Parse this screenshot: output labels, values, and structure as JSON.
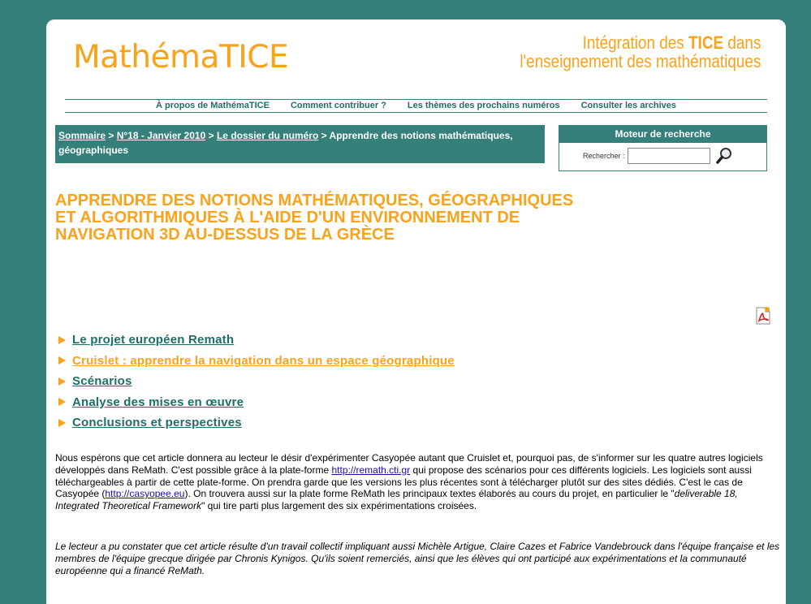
{
  "site": {
    "logo": "MathémaTICE",
    "tagline_line1_a": "Intégration des ",
    "tagline_line1_b": "TICE",
    "tagline_line1_c": " dans",
    "tagline_line2": "l'enseignement des mathématiques"
  },
  "nav": [
    "À propos de MathémaTICE",
    "Comment contribuer ?",
    "Les thèmes des prochains numéros",
    "Consulter les archives"
  ],
  "breadcrumb": {
    "home": "Sommaire",
    "sep1": " > ",
    "issue": "N°18 - Janvier 2010",
    "sep2": " > ",
    "section": "Le dossier du numéro",
    "current": " > Apprendre des notions mathématiques, géographiques"
  },
  "search": {
    "title": "Moteur de recherche",
    "label": "Rechercher :",
    "value": ""
  },
  "article": {
    "title": "APPRENDRE DES NOTIONS MATHÉMATIQUES, GÉOGRAPHIQUES ET ALGORITHMIQUES À L'AIDE D'UN ENVIRONNEMENT DE NAVIGATION 3D AU-DESSUS DE LA GRÈCE"
  },
  "toc": [
    {
      "label": "Le projet européen Remath",
      "active": false
    },
    {
      "label": "Cruislet : apprendre la navigation dans un espace géographique",
      "active": true
    },
    {
      "label": "Scénarios",
      "active": false
    },
    {
      "label": "Analyse des mises en œuvre",
      "active": false
    },
    {
      "label": "Conclusions et perspectives",
      "active": false
    }
  ],
  "para1": {
    "t1": "Nous espérons que cet article donnera au lecteur le désir d'expérimenter Casyopée autant que Cruislet et, pourquoi pas, de s'informer sur les quatre autres logiciels développés dans ReMath. C'est possible grâce à la plate-forme ",
    "link1": "http://remath.cti.gr",
    "t2": " qui propose des scénarios pour ces différents logiciels. Les logiciels sont aussi téléchargeables à partir de cette plate-forme. On prendra garde que les versions les plus récentes sont à télécharger plutôt sur des sites dédiés. C'est le cas de Casyopée (",
    "link2": "http://casyopee.eu",
    "t3": "). On trouvera aussi sur la plate forme ReMath les principaux textes élaborés au cours du projet, en particulier le \"",
    "t4": "deliverable 18, Integrated Theoretical Framework",
    "t5": "\" qui tire parti plus largement des six expérimentations croisées."
  },
  "para2": "Le lecteur a pu constater que cet article résulte d'un travail collectif impliquant aussi Michèle Artigue, Claire Cazes et Fabrice Vandebrouck dans l'équipe française et les membres de l'équipe grecque dirigée par Chronis Kynigos. Qu'ils soient remerciés, ainsi que les élèves qui ont participé aux expérimentations et la communauté européenne qui a financé ReMath.",
  "colors": {
    "accent": "#f9a21b",
    "teal": "#35807a"
  },
  "icons": [
    "magnifier-icon",
    "pdf-icon",
    "triangle-bullet-icon"
  ]
}
